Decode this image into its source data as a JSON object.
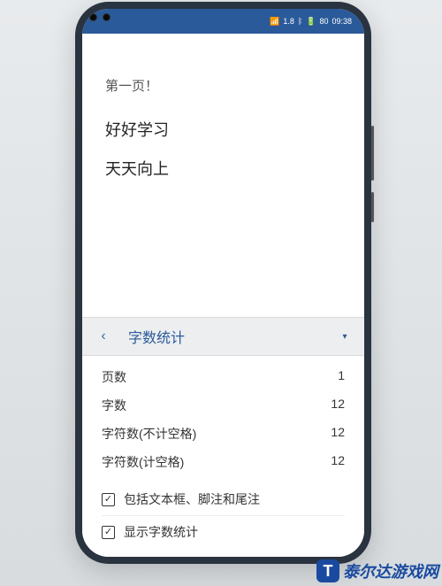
{
  "statusbar": {
    "time": "09:38",
    "battery": "80",
    "signal_text": "1.8"
  },
  "document": {
    "line1": "第一页！",
    "line2": "好好学习",
    "line3": "天天向上"
  },
  "panel": {
    "title": "字数统计"
  },
  "stats": [
    {
      "label": "页数",
      "value": "1"
    },
    {
      "label": "字数",
      "value": "12"
    },
    {
      "label": "字符数(不计空格)",
      "value": "12"
    },
    {
      "label": "字符数(计空格)",
      "value": "12"
    }
  ],
  "checks": {
    "opt1": "包括文本框、脚注和尾注",
    "opt2": "显示字数统计"
  },
  "watermark": {
    "icon": "T",
    "text": "泰尔达游戏网"
  }
}
